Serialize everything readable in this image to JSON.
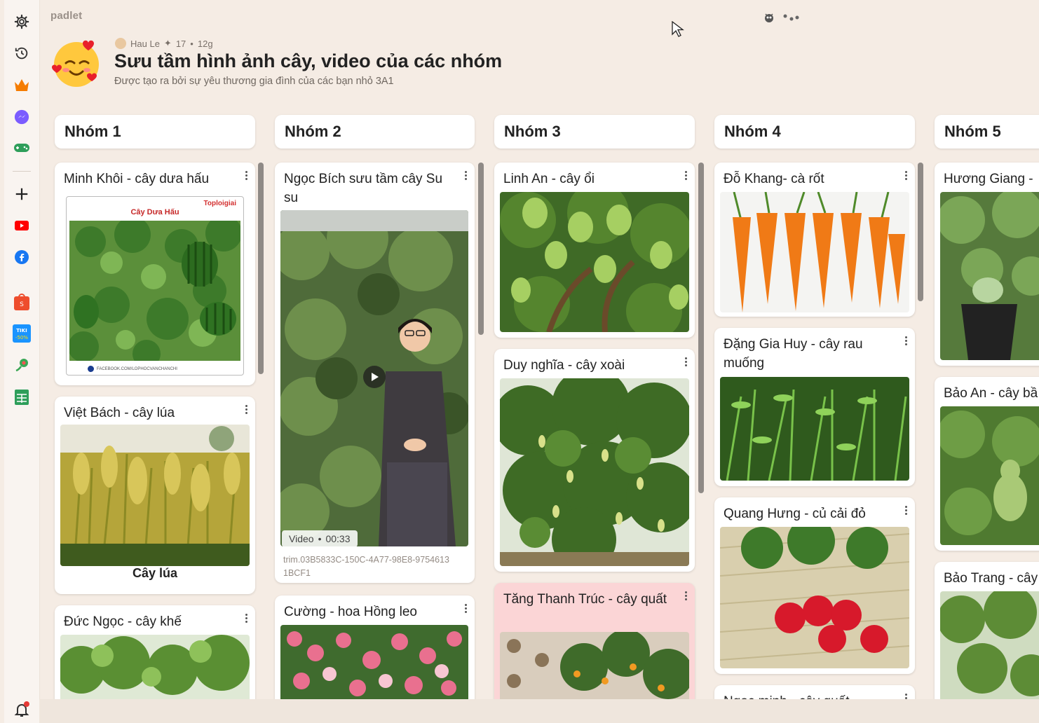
{
  "app": {
    "brand": "padlet"
  },
  "header": {
    "author": "Hau Le",
    "likes": "17",
    "time": "12g",
    "title": "Sưu tầm hình ảnh cây, video của các nhóm",
    "subtitle": "Được tạo ra bởi sự yêu thương gia đình của các bạn nhỏ 3A1"
  },
  "sidebar": {
    "icons": [
      "gear-icon",
      "history-icon",
      "crown-icon",
      "messenger-icon",
      "gamepad-icon",
      "plus-icon",
      "youtube-icon",
      "facebook-icon",
      "shopee-icon",
      "tiki-icon",
      "map-pin-icon",
      "sheet-icon",
      "bell-icon"
    ]
  },
  "columns": [
    {
      "title": "Nhóm 1"
    },
    {
      "title": "Nhóm 2"
    },
    {
      "title": "Nhóm 3"
    },
    {
      "title": "Nhóm 4"
    },
    {
      "title": "Nhóm 5"
    }
  ],
  "cards": {
    "c1a": {
      "title": "Minh Khôi - cây dưa hấu",
      "img_label": "Cây Dưa Hấu",
      "img_brand": "Toploigiai",
      "img_footer": "FACEBOOK.COM/LOPHOCVANCHANCHI"
    },
    "c1b": {
      "title": "Việt Bách - cây lúa",
      "caption": "Cây lúa"
    },
    "c1c": {
      "title": "Đức Ngọc - cây khế"
    },
    "c2a": {
      "title": "Ngọc Bích sưu tầm cây Su su",
      "video_label": "Video",
      "video_duration": "00:33",
      "filename": "trim.03B5833C-150C-4A77-98E8-97546131BCF1"
    },
    "c2b": {
      "title": "Cường - hoa Hồng leo"
    },
    "c3a": {
      "title": "Linh An - cây ổi"
    },
    "c3b": {
      "title": "Duy nghĩa - cây xoài"
    },
    "c3c": {
      "title": "Tăng Thanh Trúc - cây quất"
    },
    "c4a": {
      "title": "Đỗ Khang- cà rốt"
    },
    "c4b": {
      "title": "Đặng Gia Huy - cây rau muống"
    },
    "c4c": {
      "title": "Quang Hưng - củ cải đỏ"
    },
    "c4d": {
      "title": "Ngọc minh - cây quất"
    },
    "c5a": {
      "title": "Hương Giang -"
    },
    "c5b": {
      "title": "Bảo An - cây bầ"
    },
    "c5c": {
      "title": "Bảo Trang - cây"
    }
  },
  "colors": {
    "background": "#f5ece4",
    "card": "#ffffff",
    "pink_card": "#fbd5d6",
    "notification": "#e53935"
  }
}
